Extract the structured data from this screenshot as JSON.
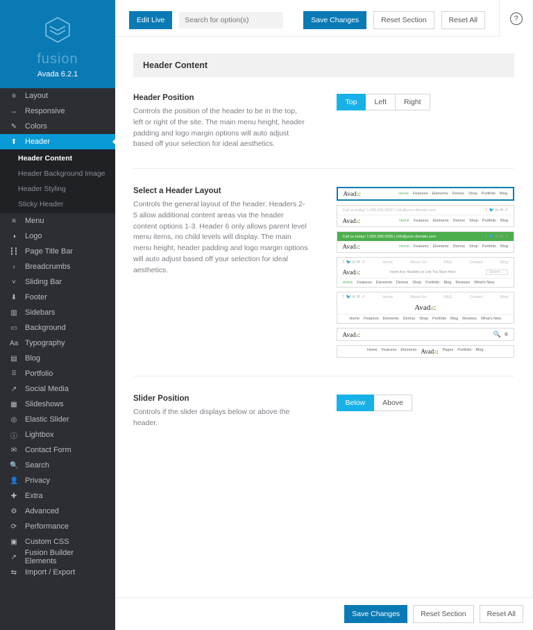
{
  "brand": {
    "word": "fusion",
    "product": "Avada",
    "version": "6.2.1"
  },
  "topbar": {
    "edit_live": "Edit Live",
    "search_placeholder": "Search for option(s)",
    "save": "Save Changes",
    "reset_section": "Reset Section",
    "reset_all": "Reset All",
    "help": "?"
  },
  "sidebar": {
    "items": [
      {
        "icon": "≡",
        "label": "Layout"
      },
      {
        "icon": "↔",
        "label": "Responsive"
      },
      {
        "icon": "✎",
        "label": "Colors"
      },
      {
        "icon": "⬆",
        "label": "Header",
        "active": true
      },
      {
        "icon": "≡",
        "label": "Menu"
      },
      {
        "icon": "◑",
        "label": "Logo"
      },
      {
        "icon": "┇┇",
        "label": "Page Title Bar"
      },
      {
        "icon": "›",
        "label": "Breadcrumbs"
      },
      {
        "icon": "˅",
        "label": "Sliding Bar"
      },
      {
        "icon": "⬇",
        "label": "Footer"
      },
      {
        "icon": "▥",
        "label": "Sidebars"
      },
      {
        "icon": "▭",
        "label": "Background"
      },
      {
        "icon": "Aa",
        "label": "Typography"
      },
      {
        "icon": "▤",
        "label": "Blog"
      },
      {
        "icon": "⠿",
        "label": "Portfolio"
      },
      {
        "icon": "↗",
        "label": "Social Media"
      },
      {
        "icon": "▦",
        "label": "Slideshows"
      },
      {
        "icon": "◎",
        "label": "Elastic Slider"
      },
      {
        "icon": "ⓘ",
        "label": "Lightbox"
      },
      {
        "icon": "✉",
        "label": "Contact Form"
      },
      {
        "icon": "🔍",
        "label": "Search"
      },
      {
        "icon": "👤",
        "label": "Privacy"
      },
      {
        "icon": "✚",
        "label": "Extra"
      },
      {
        "icon": "⚙",
        "label": "Advanced"
      },
      {
        "icon": "⟳",
        "label": "Performance"
      },
      {
        "icon": "▣",
        "label": "Custom CSS"
      },
      {
        "icon": "↗",
        "label": "Fusion Builder Elements"
      },
      {
        "icon": "⇆",
        "label": "Import / Export"
      }
    ],
    "sub": [
      {
        "label": "Header Content",
        "active": true
      },
      {
        "label": "Header Background Image"
      },
      {
        "label": "Header Styling"
      },
      {
        "label": "Sticky Header"
      }
    ]
  },
  "panel": {
    "title": "Header Content"
  },
  "header_position": {
    "title": "Header Position",
    "desc": "Controls the position of the header to be in the top, left or right of the site. The main menu height, header padding and logo margin options will auto adjust based off your selection for ideal aesthetics.",
    "options": [
      "Top",
      "Left",
      "Right"
    ],
    "selected": "Top"
  },
  "header_layout": {
    "title": "Select a Header Layout",
    "desc": "Controls the general layout of the header. Headers 2-5 allow additional content areas via the header content options 1-3. Header 6 only allows parent level menu items, no child levels will display. The main menu height, header padding and logo margin options will auto adjust based off your selection for ideal aesthetics.",
    "preview": {
      "logo": "Avada",
      "menu": [
        "Home",
        "Features",
        "Elements",
        "Demos",
        "Shop",
        "Portfolio",
        "Blog"
      ],
      "menu_alt": [
        "Home",
        "Features",
        "Elements",
        "Demos",
        "Shop",
        "Portfolio",
        "Blog",
        "Reviews",
        "What's New"
      ],
      "rightnav": [
        "Home",
        "About Us",
        "FAQ",
        "Contact",
        "Blog"
      ],
      "contact": "Call us today!  1.555.555.5555  |  info@your-domain.com",
      "headline": "Insert Any Headline or Link You Want Here",
      "search_ph": "Search …",
      "centered_menu": [
        "Home",
        "Features",
        "Elements",
        "Avada",
        "Pages",
        "Portfolio",
        "Blog"
      ]
    }
  },
  "slider_position": {
    "title": "Slider Position",
    "desc": "Controls if the slider displays below or above the header.",
    "options": [
      "Below",
      "Above"
    ],
    "selected": "Below"
  },
  "bottombar": {
    "save": "Save Changes",
    "reset_section": "Reset Section",
    "reset_all": "Reset All"
  }
}
